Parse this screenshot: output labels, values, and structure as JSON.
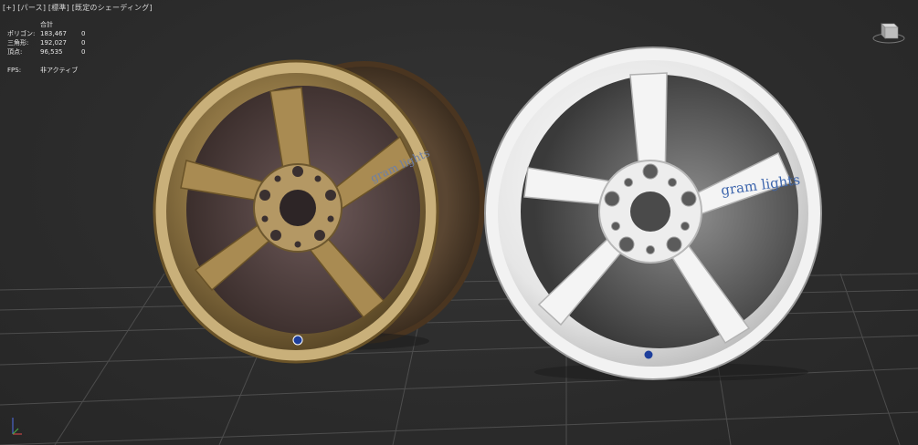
{
  "viewport": {
    "menu": "[+]",
    "view": "[パース]",
    "mode": "[標準]",
    "shading": "[既定のシェーディング]"
  },
  "stats": {
    "header": "合計",
    "rows": [
      {
        "label": "ポリゴン:",
        "value": "183,467",
        "extra": "0"
      },
      {
        "label": "三角形:",
        "value": "192,027",
        "extra": "0"
      },
      {
        "label": "頂点:",
        "value": "96,535",
        "extra": "0"
      }
    ],
    "fps_label": "FPS:",
    "fps_value": "非アクティブ"
  },
  "wheels": {
    "scanned_logo": "gram lights",
    "clean_logo": "gram lights"
  },
  "colors": {
    "background": "#2c2c2c",
    "grid": "#5a5a5a",
    "bronze": "#8a7240",
    "white_wheel": "#ededed",
    "logo_blue": "#3e66ad",
    "valve_blue": "#1e3f9c"
  }
}
